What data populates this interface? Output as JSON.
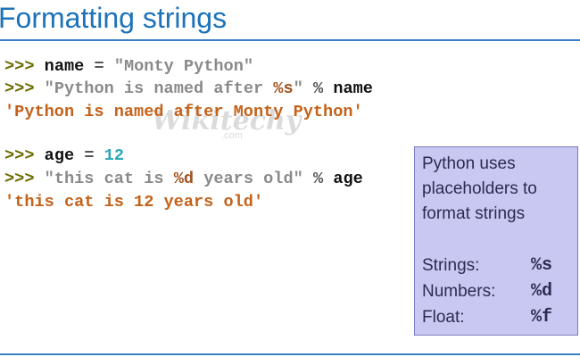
{
  "title": "Formatting strings",
  "watermark": {
    "brand": "Wikitechy",
    "domain": ".com"
  },
  "code": {
    "line1": {
      "prompt": ">>>",
      "var": "name",
      "op": "=",
      "value": "\"Monty Python\""
    },
    "line2": {
      "prompt": ">>>",
      "str_a": "\"Python is named after ",
      "fmt": "%s",
      "str_b": "\"",
      "op": "%",
      "var": "name"
    },
    "line3": {
      "output": "'Python is named after Monty Python'"
    },
    "line4": {
      "prompt": ">>>",
      "var": "age",
      "op": "=",
      "value": "12"
    },
    "line5": {
      "prompt": ">>>",
      "str_a": "\"this cat is ",
      "fmt": "%d",
      "str_b": " years old\"",
      "op": "%",
      "var": "age"
    },
    "line6": {
      "output": "'this cat is 12 years old'"
    }
  },
  "callout": {
    "line1": "Python uses",
    "line2": "placeholders to",
    "line3": "format  strings",
    "strings_label": "Strings:",
    "strings_code": "%s",
    "numbers_label": "Numbers:",
    "numbers_code": "%d",
    "float_label": "Float:",
    "float_code": "%f"
  },
  "colors": {
    "title": "#1d72b8",
    "prompt": "#6b6b00",
    "output": "#c4621a",
    "number": "#27a7b8",
    "callout_bg": "#c8c8f2"
  }
}
